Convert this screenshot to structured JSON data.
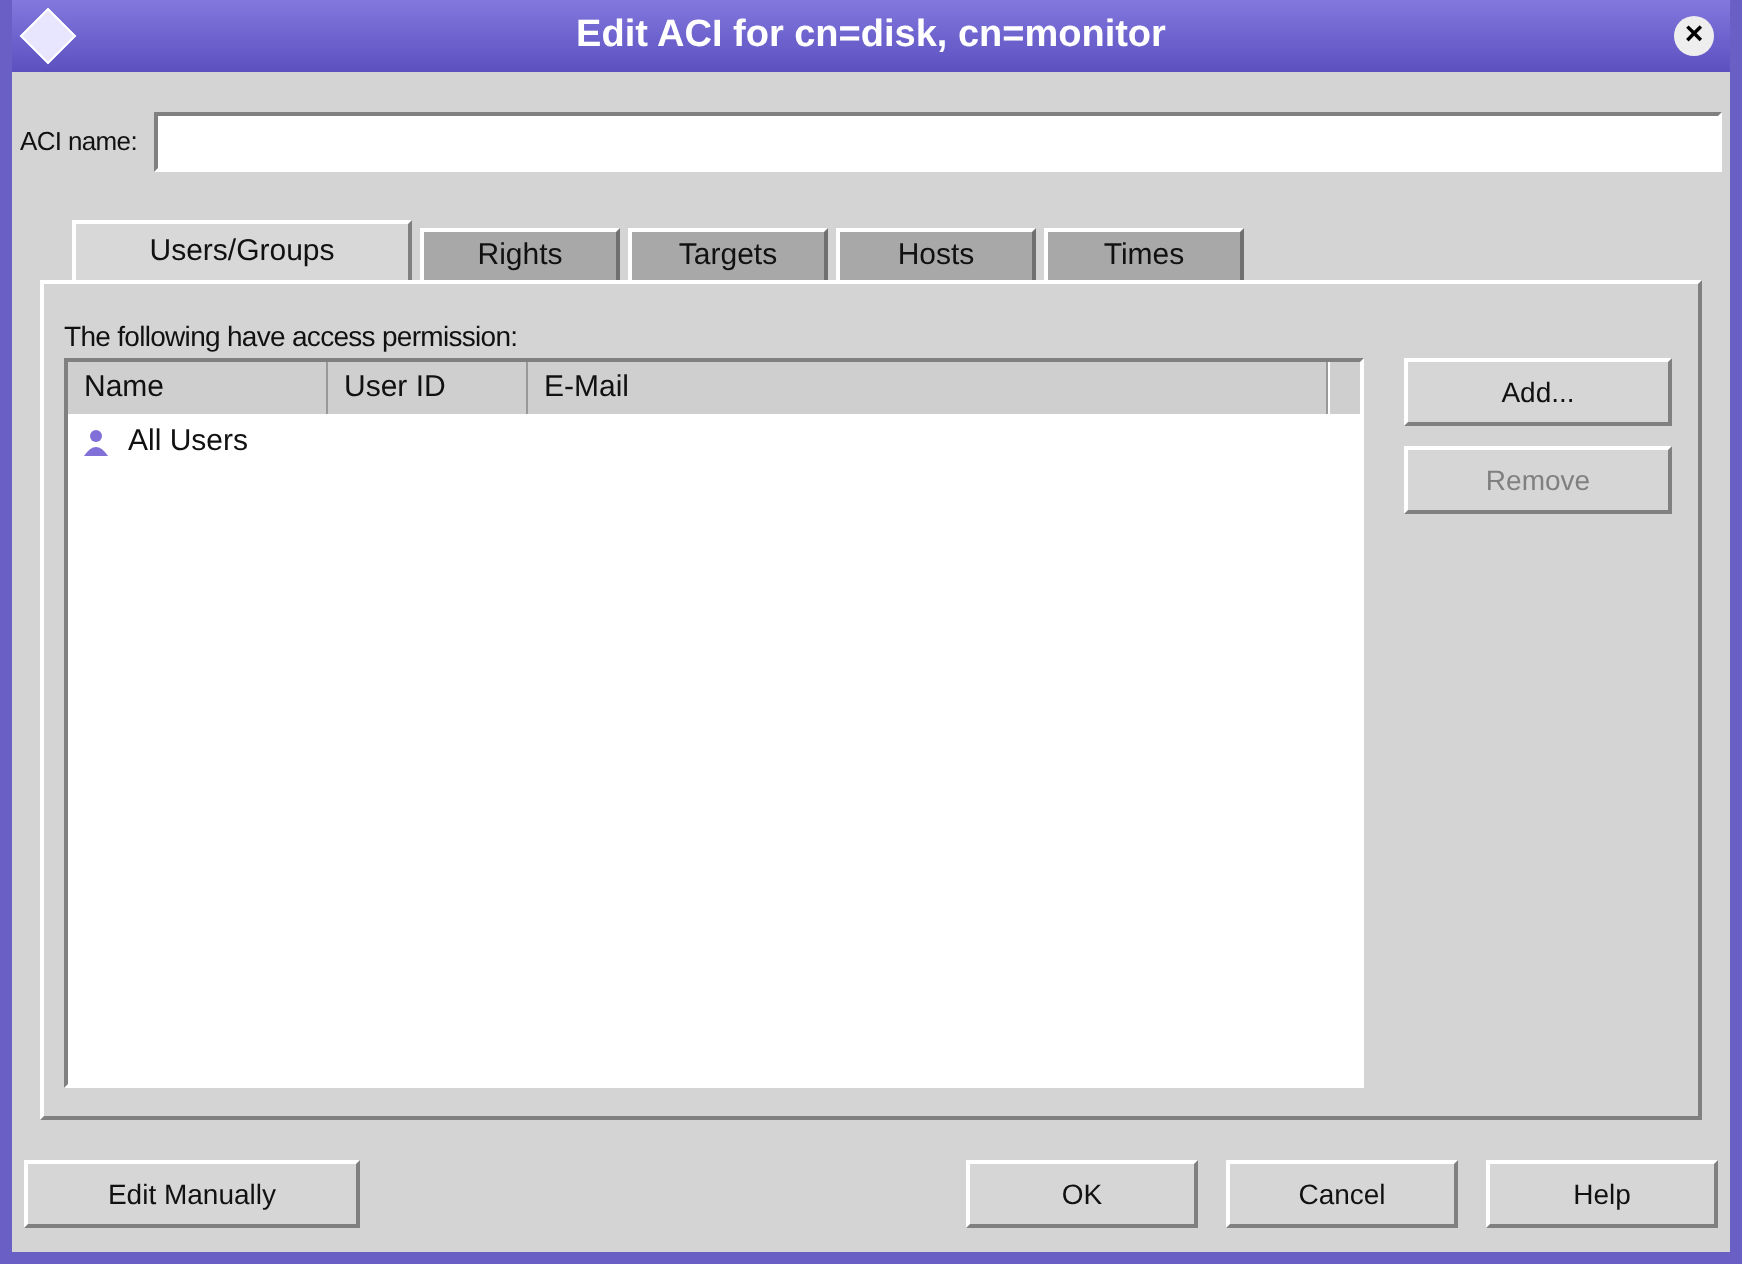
{
  "window": {
    "title": "Edit ACI for cn=disk, cn=monitor",
    "close": "×"
  },
  "aci_name": {
    "label": "ACI name:"
  },
  "tabs": [
    {
      "label": "Users/Groups",
      "selected": true
    },
    {
      "label": "Rights",
      "selected": false
    },
    {
      "label": "Targets",
      "selected": false
    },
    {
      "label": "Hosts",
      "selected": false
    },
    {
      "label": "Times",
      "selected": false
    }
  ],
  "caption": "The following have access permission:",
  "table": {
    "columns": [
      "Name",
      "User ID",
      "E-Mail"
    ],
    "rows": [
      {
        "name": "All Users"
      }
    ]
  },
  "side_buttons": [
    {
      "label": "Add...",
      "disabled": false
    },
    {
      "label": "Remove",
      "disabled": true
    }
  ],
  "footer_left": {
    "label": "Edit Manually"
  },
  "footer_buttons": [
    "OK",
    "Cancel",
    "Help"
  ]
}
